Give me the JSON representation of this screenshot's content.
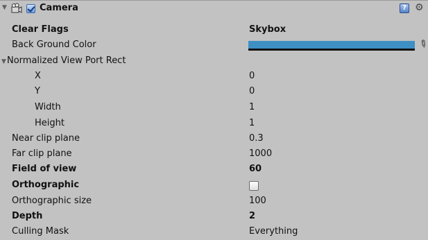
{
  "component": {
    "title": "Camera",
    "enabled": true,
    "icons": {
      "fold": "triangle-down-icon",
      "component": "camera-icon",
      "help": "help-book-icon",
      "settings": "gear-icon"
    },
    "help_glyph": "?"
  },
  "properties": {
    "clear_flags": {
      "label": "Clear Flags",
      "value": "Skybox"
    },
    "background_color": {
      "label": "Back Ground Color",
      "color": "#3d8fc4"
    },
    "viewport_rect": {
      "label": "Normalized View Port Rect",
      "x": {
        "label": "X",
        "value": "0"
      },
      "y": {
        "label": "Y",
        "value": "0"
      },
      "width": {
        "label": "Width",
        "value": "1"
      },
      "height": {
        "label": "Height",
        "value": "1"
      }
    },
    "near_clip": {
      "label": "Near clip plane",
      "value": "0.3"
    },
    "far_clip": {
      "label": "Far clip plane",
      "value": "1000"
    },
    "fov": {
      "label": "Field of view",
      "value": "60"
    },
    "orthographic": {
      "label": "Orthographic",
      "checked": false
    },
    "ortho_size": {
      "label": "Orthographic size",
      "value": "100"
    },
    "depth": {
      "label": "Depth",
      "value": "2"
    },
    "culling_mask": {
      "label": "Culling Mask",
      "value": "Everything"
    }
  }
}
